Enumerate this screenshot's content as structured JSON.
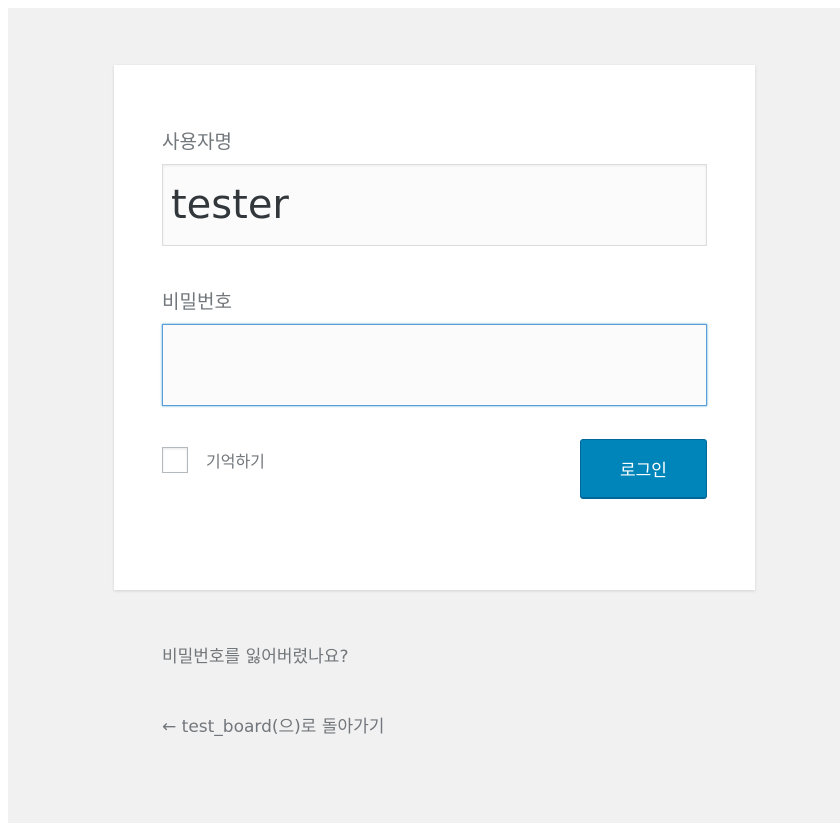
{
  "login_form": {
    "username_label": "사용자명",
    "username_value": "tester",
    "password_label": "비밀번호",
    "password_value": "",
    "remember_label": "기억하기",
    "remember_checked": false,
    "submit_label": "로그인"
  },
  "footer_links": {
    "lost_password": "비밀번호를 잃어버렸나요?",
    "back_to_site": "← test_board(으)로 돌아가기"
  },
  "colors": {
    "background": "#f1f1f1",
    "card": "#ffffff",
    "button": "#0085ba",
    "focus_border": "#5b9dd9",
    "text_muted": "#72777c"
  }
}
